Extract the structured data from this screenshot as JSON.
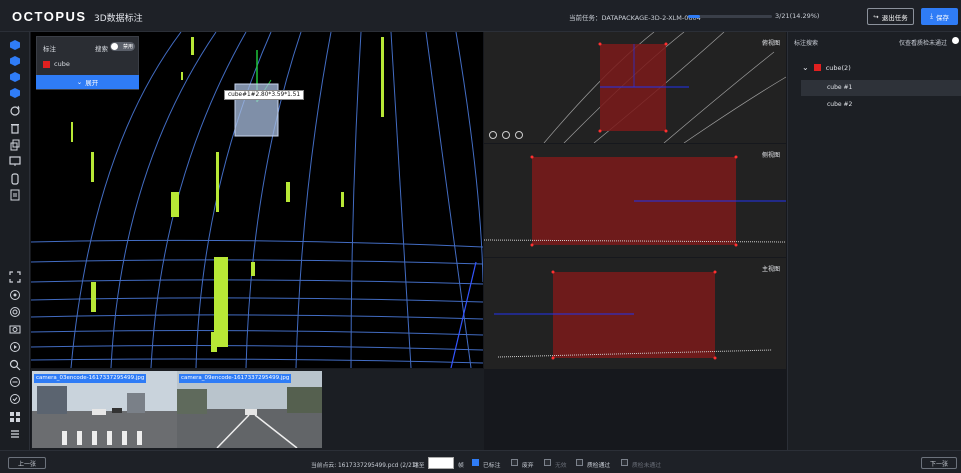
{
  "header": {
    "brand": "OCTOPUS",
    "subtitle": "3D数据标注",
    "task": "当前任务：DATAPACKAGE-3D-2-XLM-0604",
    "progress_fraction": 0.1429,
    "progress_text": "3/21(14.29%)",
    "exit_label": "退出任务",
    "save_label": "保存"
  },
  "toolbar": {
    "icons": [
      "cube-icon",
      "cube-icon",
      "cube-icon",
      "cube-icon",
      "rotate-icon",
      "delete-icon",
      "copy-icon",
      "monitor-icon",
      "brush-icon",
      "file-icon",
      "scan-icon",
      "focus-icon",
      "settings-icon",
      "camera-icon",
      "record-icon",
      "search-icon",
      "circle-icon",
      "checklist-icon",
      "grid-icon",
      "list-icon"
    ]
  },
  "label_panel": {
    "title": "标注",
    "search_label": "搜索",
    "toggle_label": "禁用",
    "item_label": "cube",
    "item_color": "#e02020",
    "expand_label": "展开"
  },
  "tooltip": "cube#1#2.80*3.59*1.51",
  "views": {
    "top": "俯视图",
    "side": "侧视图",
    "front": "主视图"
  },
  "right_panel": {
    "title": "标注搜索",
    "filter": "仅查看质检未通过",
    "group": "cube(2)",
    "group_color": "#e02020",
    "items": [
      "cube #1",
      "cube #2"
    ]
  },
  "thumbnails": [
    {
      "caption": "camera_03encode-1617337295499.jpg"
    },
    {
      "caption": "camera_09encode-1617337295499.jpg"
    }
  ],
  "bottom": {
    "prev": "上一张",
    "next": "下一张",
    "status": "当前点云: 1617337295499.pcd (2/21)",
    "goto": "跳至",
    "frame": "帧",
    "checks": [
      {
        "label": "已标注",
        "checked": true,
        "dim": false
      },
      {
        "label": "废弃",
        "checked": false,
        "dim": false
      },
      {
        "label": "无效",
        "checked": false,
        "dim": true
      },
      {
        "label": "质检通过",
        "checked": false,
        "dim": false
      },
      {
        "label": "质检未通过",
        "checked": false,
        "dim": true
      }
    ]
  },
  "colors": {
    "accent": "#2f7cf6",
    "cube": "#e02020"
  }
}
